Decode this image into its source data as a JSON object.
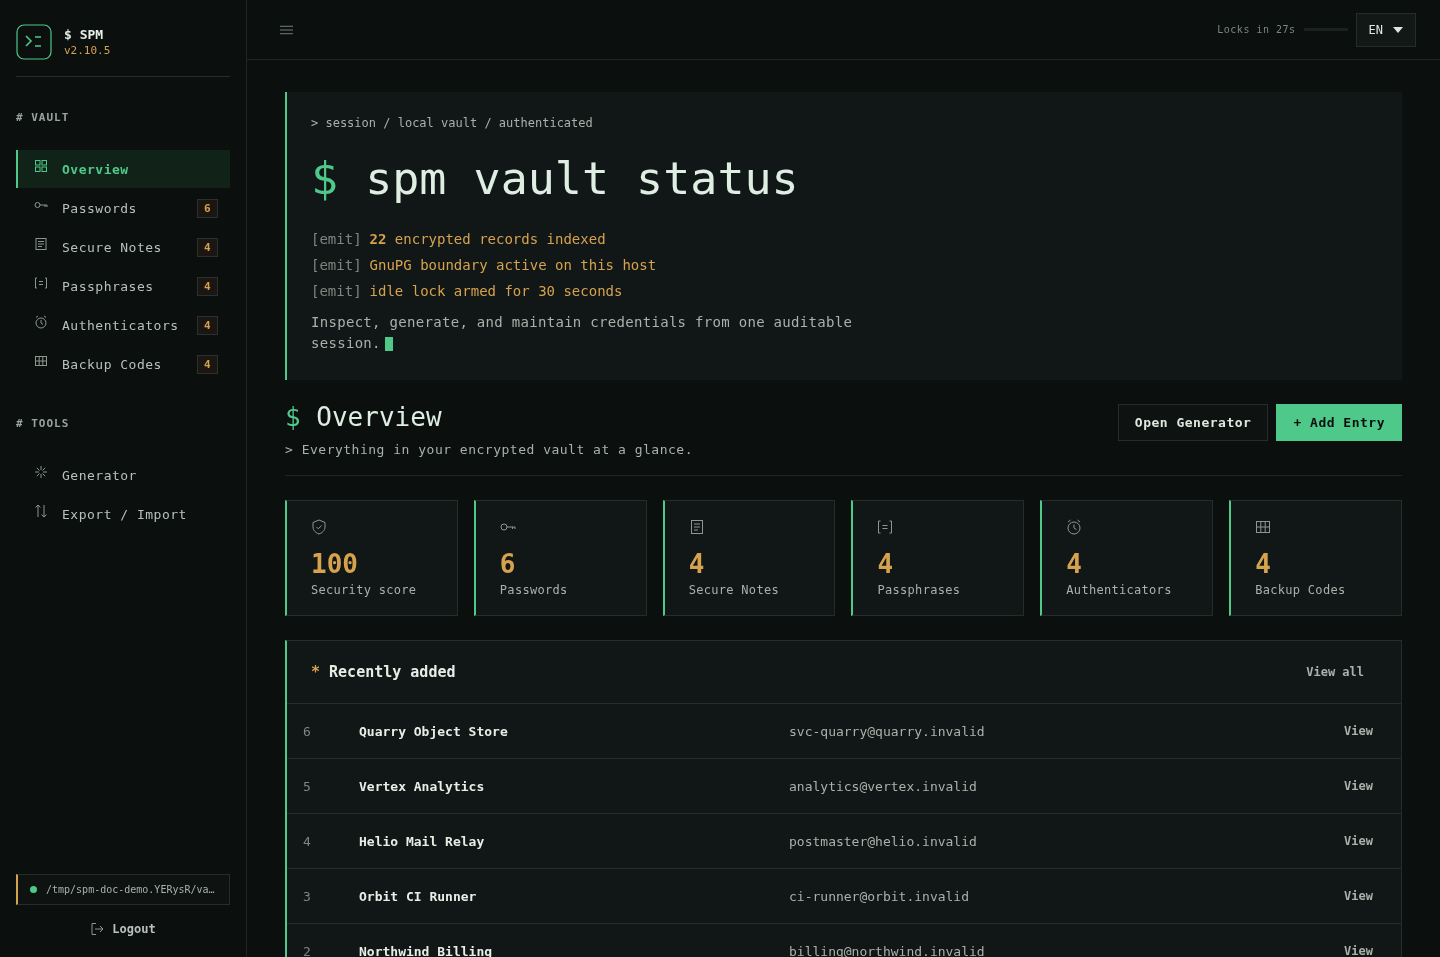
{
  "brand": {
    "title": "$ SPM",
    "version": "v2.10.5"
  },
  "sidebar": {
    "sections": [
      {
        "heading": "# VAULT",
        "items": [
          {
            "label": "Overview",
            "selected": true
          },
          {
            "label": "Passwords",
            "count": "6",
            "selected": false
          },
          {
            "label": "Secure Notes",
            "count": "4",
            "selected": false
          },
          {
            "label": "Passphrases",
            "count": "4",
            "selected": false
          },
          {
            "label": "Authenticators",
            "count": "4",
            "selected": false
          },
          {
            "label": "Backup Codes",
            "count": "4",
            "selected": false
          }
        ]
      },
      {
        "heading": "# TOOLS",
        "items": [
          {
            "label": "Generator",
            "selected": false
          },
          {
            "label": "Export / Import",
            "selected": false
          }
        ]
      }
    ],
    "vault_path": "/tmp/spm-doc-demo.YERysR/va…",
    "logout": "Logout"
  },
  "topbar": {
    "lock_text": "Locks in 27s",
    "language": "EN"
  },
  "hero": {
    "breadcrumb": "> session / local vault / authenticated",
    "prompt": "$",
    "title": "spm vault status",
    "emits": [
      {
        "tag": "[emit]",
        "text": "**22** encrypted records indexed"
      },
      {
        "tag": "[emit]",
        "text": "GnuPG boundary active on this host"
      },
      {
        "tag": "[emit]",
        "text": "idle lock armed for 30 seconds"
      }
    ],
    "description": "Inspect, generate, and maintain credentials from one auditable session."
  },
  "overview": {
    "prompt": "$",
    "title": "Overview",
    "subtitle": "> Everything in your encrypted vault at a glance.",
    "buttons": [
      {
        "label": "Open Generator",
        "kind": "secondary"
      },
      {
        "label": "+ Add Entry",
        "kind": "primary"
      }
    ]
  },
  "stats": [
    {
      "value": "100",
      "label": "Security score"
    },
    {
      "value": "6",
      "label": "Passwords"
    },
    {
      "value": "4",
      "label": "Secure Notes"
    },
    {
      "value": "4",
      "label": "Passphrases"
    },
    {
      "value": "4",
      "label": "Authenticators"
    },
    {
      "value": "4",
      "label": "Backup Codes"
    }
  ],
  "recent": {
    "marker": "*",
    "title": "Recently added",
    "view_all": "View all",
    "rows": [
      {
        "id": "6",
        "name": "Quarry Object Store",
        "account": "svc-quarry@quarry.invalid",
        "action": "View"
      },
      {
        "id": "5",
        "name": "Vertex Analytics",
        "account": "analytics@vertex.invalid",
        "action": "View"
      },
      {
        "id": "4",
        "name": "Helio Mail Relay",
        "account": "postmaster@helio.invalid",
        "action": "View"
      },
      {
        "id": "3",
        "name": "Orbit CI Runner",
        "account": "ci-runner@orbit.invalid",
        "action": "View"
      },
      {
        "id": "2",
        "name": "Northwind Billing",
        "account": "billing@northwind.invalid",
        "action": "View"
      }
    ]
  }
}
